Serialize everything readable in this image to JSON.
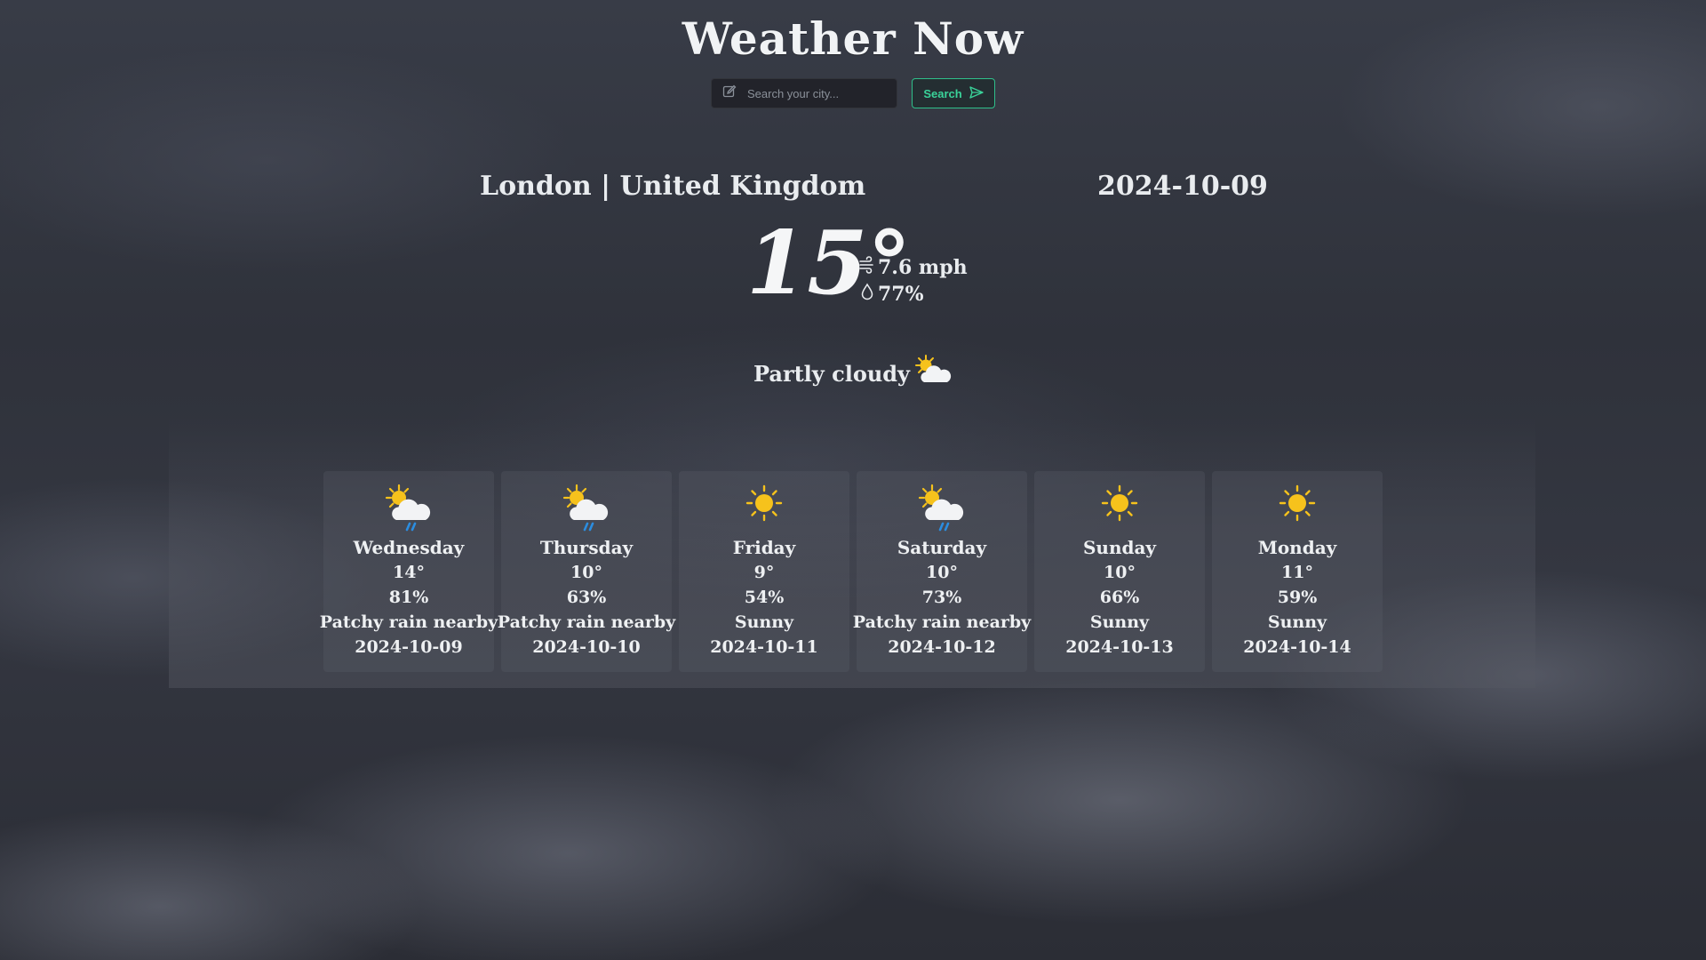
{
  "header": {
    "title": "Weather Now"
  },
  "search": {
    "placeholder": "Search your city...",
    "value": "",
    "button_label": "Search"
  },
  "current": {
    "location": "London | United Kingdom",
    "date": "2024-10-09",
    "temperature": "15°",
    "wind": "7.6 mph",
    "humidity": "77%",
    "condition": "Partly cloudy"
  },
  "forecast": [
    {
      "day": "Wednesday",
      "temp": "14°",
      "humidity": "81%",
      "condition": "Patchy rain nearby",
      "date": "2024-10-09",
      "icon": "patchy-rain-icon"
    },
    {
      "day": "Thursday",
      "temp": "10°",
      "humidity": "63%",
      "condition": "Patchy rain nearby",
      "date": "2024-10-10",
      "icon": "patchy-rain-icon"
    },
    {
      "day": "Friday",
      "temp": "9°",
      "humidity": "54%",
      "condition": "Sunny",
      "date": "2024-10-11",
      "icon": "sun-icon"
    },
    {
      "day": "Saturday",
      "temp": "10°",
      "humidity": "73%",
      "condition": "Patchy rain nearby",
      "date": "2024-10-12",
      "icon": "patchy-rain-icon"
    },
    {
      "day": "Sunday",
      "temp": "10°",
      "humidity": "66%",
      "condition": "Sunny",
      "date": "2024-10-13",
      "icon": "sun-icon"
    },
    {
      "day": "Monday",
      "temp": "11°",
      "humidity": "59%",
      "condition": "Sunny",
      "date": "2024-10-14",
      "icon": "sun-icon"
    }
  ],
  "colors": {
    "accent": "#3ad39a",
    "sun": "#f6c21c",
    "rain": "#2b8de0"
  }
}
